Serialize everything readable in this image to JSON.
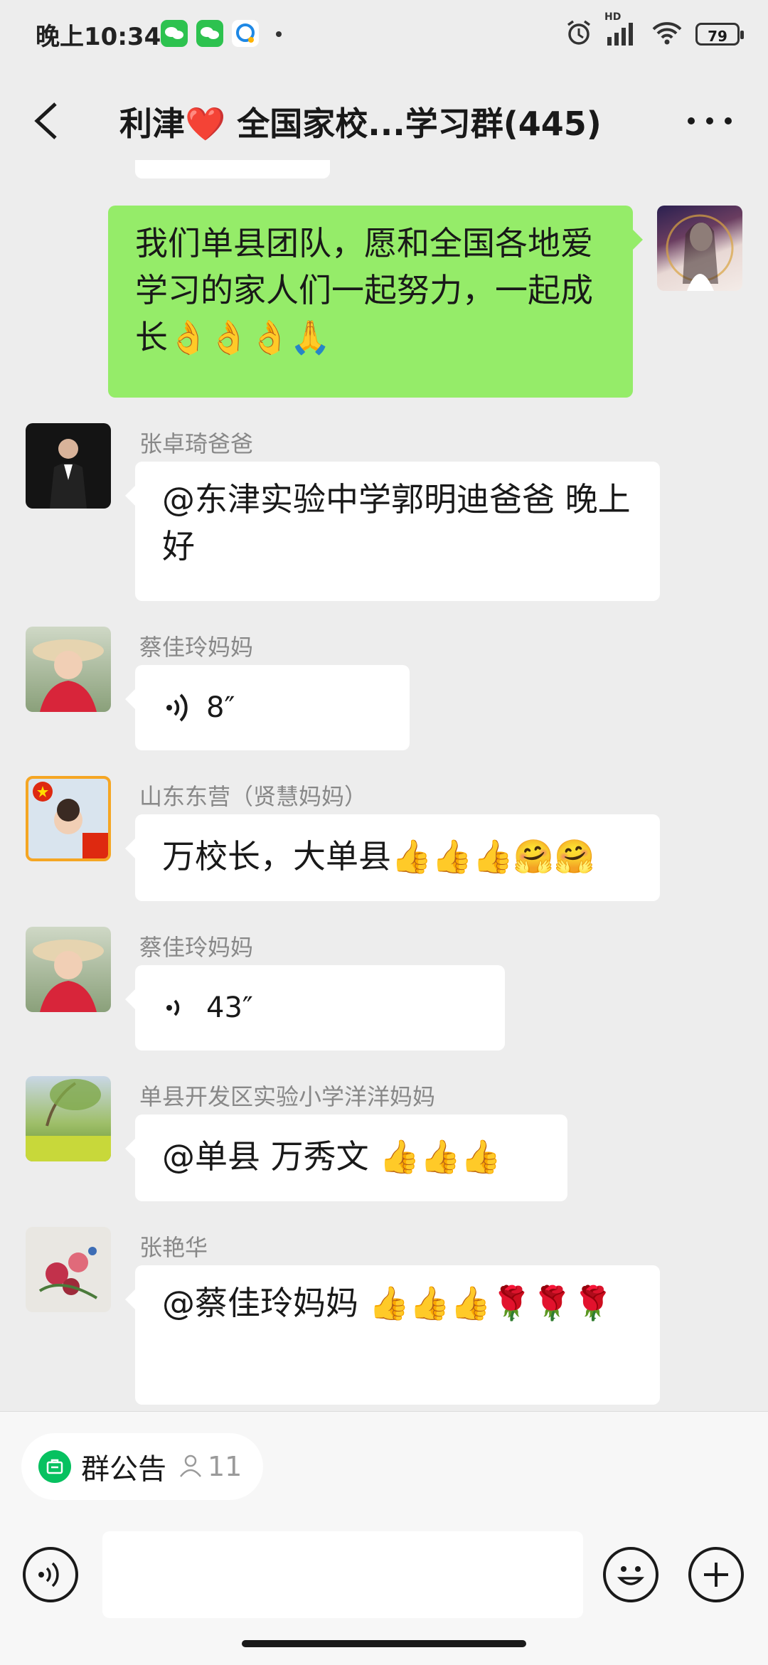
{
  "status_bar": {
    "time": "晚上10:34",
    "battery": "79",
    "network": "HD"
  },
  "header": {
    "title": "利津❤️ 全国家校...学习群(445)"
  },
  "messages": [
    {
      "sender": "",
      "text": "我们单县团队，愿和全国各地爱学习的家人们一起努力，一起成长👌👌👌🙏",
      "self": true
    },
    {
      "sender": "张卓琦爸爸",
      "text": "@东津实验中学郭明迪爸爸  晚上好"
    },
    {
      "sender": "蔡佳玲妈妈",
      "voice": "8″"
    },
    {
      "sender": "山东东营（贤慧妈妈）",
      "text": "万校长，大单县👍👍👍🤗🤗"
    },
    {
      "sender": "蔡佳玲妈妈",
      "voice": "43″"
    },
    {
      "sender": "单县开发区实验小学洋洋妈妈",
      "text": "@单县 万秀文 👍👍👍"
    },
    {
      "sender": "张艳华",
      "text": "@蔡佳玲妈妈  👍👍👍🌹🌹🌹"
    }
  ],
  "bottom": {
    "notice_label": "群公告",
    "notice_count": "11"
  },
  "colors": {
    "self_bubble": "#95ec69",
    "background": "#ededed",
    "wechat_green": "#07c160"
  },
  "icons": [
    "back-icon",
    "more-icon",
    "voice-icon",
    "emoji-icon",
    "plus-icon",
    "notice-icon",
    "person-icon",
    "alarm-icon",
    "signal-icon",
    "wifi-icon",
    "battery-icon"
  ]
}
